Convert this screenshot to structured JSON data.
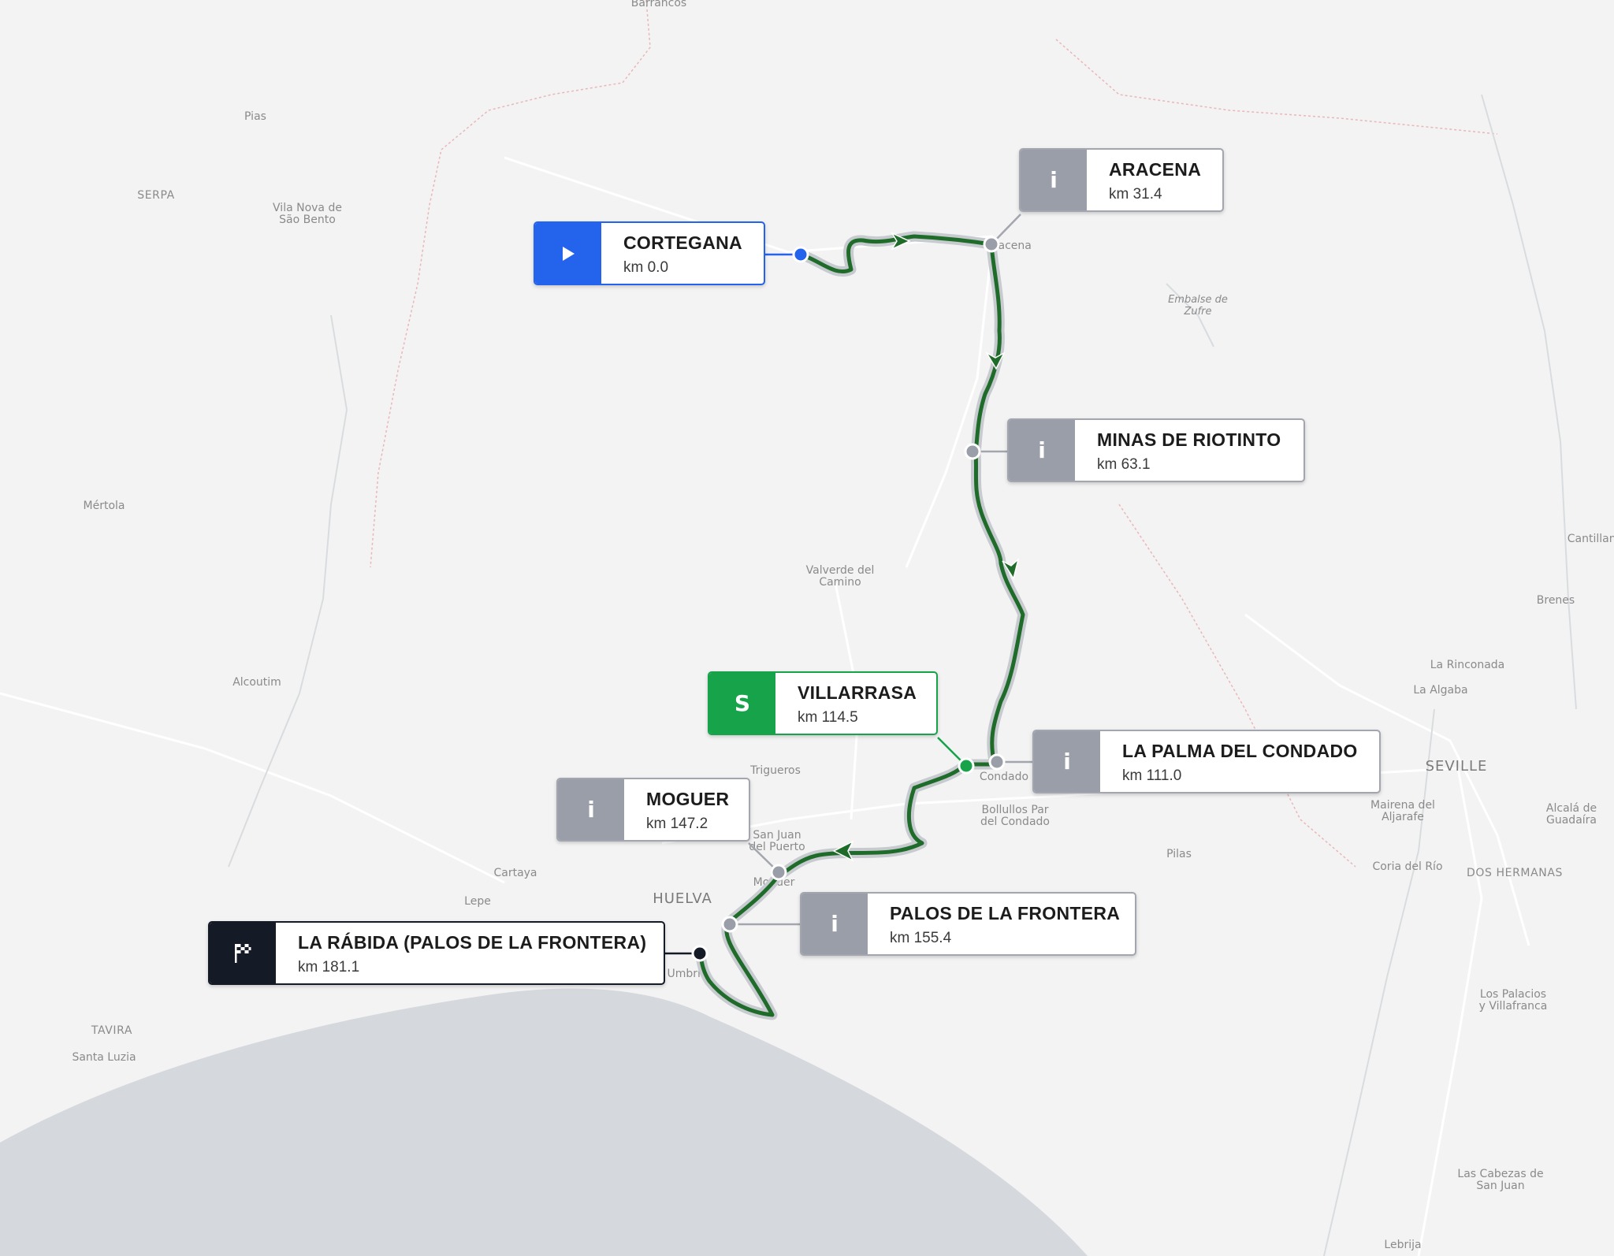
{
  "map": {
    "background_color": "#f3f3f3",
    "sea_color": "#d5d8dc",
    "route_color": "#1f6b2a",
    "places": [
      {
        "key": "barrancos",
        "name": "Barrancos"
      },
      {
        "key": "pias",
        "name": "Pias"
      },
      {
        "key": "serpa",
        "name": "SERPA"
      },
      {
        "key": "vila_nova",
        "name": "Vila Nova de São Bento"
      },
      {
        "key": "mertola",
        "name": "Mértola"
      },
      {
        "key": "alcoutim",
        "name": "Alcoutim"
      },
      {
        "key": "tavira",
        "name": "TAVIRA"
      },
      {
        "key": "santa_luzia",
        "name": "Santa Luzia"
      },
      {
        "key": "valverde",
        "name": "Valverde del Camino"
      },
      {
        "key": "trigueros",
        "name": "Trigueros"
      },
      {
        "key": "cartaya",
        "name": "Cartaya"
      },
      {
        "key": "lepe",
        "name": "Lepe"
      },
      {
        "key": "huelva",
        "name": "HUELVA"
      },
      {
        "key": "san_juan",
        "name": "San Juan del Puerto"
      },
      {
        "key": "moguer_map",
        "name": "Moguer"
      },
      {
        "key": "umbria",
        "name": "Umbría"
      },
      {
        "key": "bollullos",
        "name": "Bollullos Par del Condado"
      },
      {
        "key": "condado",
        "name": "Condado"
      },
      {
        "key": "aracena_map",
        "name": "Aracena"
      },
      {
        "key": "pilas",
        "name": "Pilas"
      },
      {
        "key": "embalse",
        "name": "Embalse de Zufre"
      },
      {
        "key": "cantillana",
        "name": "Cantillana"
      },
      {
        "key": "brenes",
        "name": "Brenes"
      },
      {
        "key": "la_rinconada",
        "name": "La Rinconada"
      },
      {
        "key": "la_algaba",
        "name": "La Algaba"
      },
      {
        "key": "seville",
        "name": "SEVILLE"
      },
      {
        "key": "mairena",
        "name": "Mairena del Aljarafe"
      },
      {
        "key": "alcala",
        "name": "Alcalá de Guadaíra"
      },
      {
        "key": "coria",
        "name": "Coria del Río"
      },
      {
        "key": "dos_hermanas",
        "name": "DOS HERMANAS"
      },
      {
        "key": "los_palacios",
        "name": "Los Palacios y Villafranca"
      },
      {
        "key": "las_cabezas",
        "name": "Las Cabezas de San Juan"
      },
      {
        "key": "lebrija",
        "name": "Lebrija"
      }
    ]
  },
  "waypoints": [
    {
      "key": "cortegana",
      "type": "start",
      "icon": "play-icon",
      "name": "CORTEGANA",
      "km": "km 0.0"
    },
    {
      "key": "aracena",
      "type": "info",
      "icon": "info-icon",
      "badge": "i",
      "name": "ARACENA",
      "km": "km 31.4"
    },
    {
      "key": "minas",
      "type": "info",
      "icon": "info-icon",
      "badge": "i",
      "name": "MINAS DE RIOTINTO",
      "km": "km 63.1"
    },
    {
      "key": "villarrasa",
      "type": "sprint",
      "icon": "sprint-icon",
      "badge": "S",
      "name": "VILLARRASA",
      "km": "km 114.5"
    },
    {
      "key": "la_palma",
      "type": "info",
      "icon": "info-icon",
      "badge": "i",
      "name": "LA PALMA DEL CONDADO",
      "km": "km 111.0"
    },
    {
      "key": "moguer",
      "type": "info",
      "icon": "info-icon",
      "badge": "i",
      "name": "MOGUER",
      "km": "km 147.2"
    },
    {
      "key": "palos",
      "type": "info",
      "icon": "info-icon",
      "badge": "i",
      "name": "PALOS DE LA FRONTERA",
      "km": "km 155.4"
    },
    {
      "key": "la_rabida",
      "type": "finish",
      "icon": "checkered-flag-icon",
      "name": "LA RÁBIDA (PALOS DE LA FRONTERA)",
      "km": "km 181.1"
    }
  ]
}
